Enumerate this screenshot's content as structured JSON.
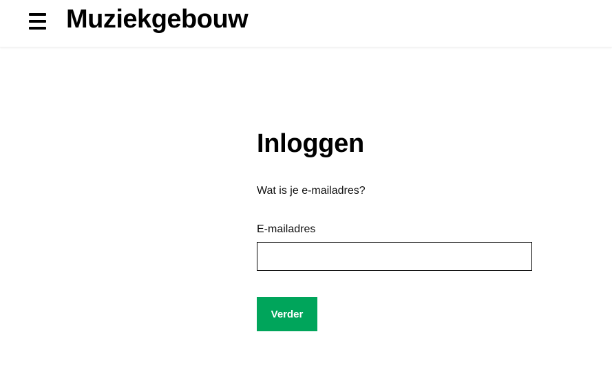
{
  "header": {
    "logo_text": "Muziekgebouw",
    "menu_icon": "hamburger-menu-icon"
  },
  "login": {
    "title": "Inloggen",
    "question": "Wat is je e-mailadres?",
    "email_label": "E-mailadres",
    "email_value": "",
    "email_placeholder": "",
    "submit_label": "Verder"
  },
  "colors": {
    "accent": "#00a55b",
    "text": "#000000",
    "background": "#ffffff"
  }
}
